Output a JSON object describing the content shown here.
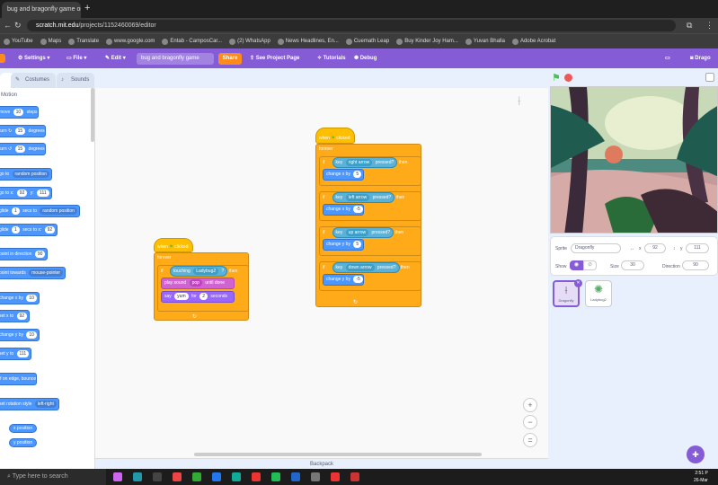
{
  "browser": {
    "tab_title": "bug and bragonfly game on Sc",
    "new_tab": "+",
    "url_host": "scratch.mit.edu",
    "url_path": "/projects/1152460069/editor",
    "bookmarks": [
      "YouTube",
      "Maps",
      "Translate",
      "www.google.com",
      "Entab - CamposCar...",
      "(2) WhatsApp",
      "News Headlines, En...",
      "Cuemath Leap",
      "Buy Kinder Joy Ham...",
      "Yuvan Bhalla",
      "Adobe Acrobat"
    ]
  },
  "menu": {
    "settings": "Settings",
    "file": "File",
    "edit": "Edit",
    "project_title": "bug and bragonfly game",
    "share": "Share",
    "see_project": "See Project Page",
    "tutorials": "Tutorials",
    "debug": "Debug",
    "username": "Drago"
  },
  "editor_tabs": {
    "code": "",
    "costumes": "Costumes",
    "sounds": "Sounds"
  },
  "palette": {
    "category": "Motion",
    "blocks": [
      {
        "text": "move",
        "v1": "10",
        "t2": "steps"
      },
      {
        "text": "turn ↻",
        "v1": "15",
        "t2": "degrees"
      },
      {
        "text": "turn ↺",
        "v1": "15",
        "t2": "degrees"
      },
      {
        "text": "go to",
        "dd": "random position"
      },
      {
        "text": "go to x:",
        "v1": "92",
        "t2": "y:",
        "v2": "111"
      },
      {
        "text": "glide",
        "v1": "1",
        "t2": "secs to",
        "dd": "random position"
      },
      {
        "text": "glide",
        "v1": "1",
        "t2": "secs to x:",
        "v2": "92"
      },
      {
        "text": "point in direction",
        "v1": "90"
      },
      {
        "text": "point towards",
        "dd": "mouse-pointer"
      },
      {
        "text": "change x by",
        "v1": "10"
      },
      {
        "text": "set x to",
        "v1": "92"
      },
      {
        "text": "change y by",
        "v1": "10"
      },
      {
        "text": "set y to",
        "v1": "111"
      },
      {
        "text": "if on edge, bounce"
      },
      {
        "text": "set rotation style",
        "dd": "left-right"
      }
    ],
    "reporters": [
      "x position",
      "y position"
    ]
  },
  "script1": {
    "hat": "when",
    "hat_tail": "clicked",
    "forever": "forever",
    "if": "if",
    "touching": "touching",
    "touching_target": "Ladybug2",
    "touching_q": "?",
    "then": "then",
    "play_sound": "play sound",
    "sound": "pop",
    "until_done": "until done",
    "say": "say",
    "say_text": "yum",
    "for": "for",
    "say_secs": "2",
    "seconds": "seconds"
  },
  "script2": {
    "hat": "when",
    "hat_tail": "clicked",
    "forever": "forever",
    "conditions": [
      {
        "key": "right arrow",
        "action": "change x by",
        "value": "5"
      },
      {
        "key": "left arrow",
        "action": "change x by",
        "value": "-5"
      },
      {
        "key": "up arrow",
        "action": "change y by",
        "value": "5"
      },
      {
        "key": "down arrow",
        "action": "change y by",
        "value": "-5"
      }
    ],
    "key_label": "key",
    "pressed": "pressed?",
    "then": "then",
    "if": "if"
  },
  "backpack": "Backpack",
  "sprite_info": {
    "sprite_label": "Sprite",
    "sprite_name": "Dragonfly",
    "x_label": "x",
    "x": "92",
    "y_label": "y",
    "y": "111",
    "show_label": "Show",
    "size_label": "Size",
    "size": "30",
    "direction_label": "Direction",
    "direction": "90"
  },
  "sprites": [
    {
      "name": "Dragonfly",
      "selected": true
    },
    {
      "name": "Ladybug2",
      "selected": false
    }
  ],
  "taskbar": {
    "search": "Type here to search",
    "time": "2:51 P",
    "date": "26-Mar"
  },
  "colors": {
    "menu": "#855cd6",
    "motion": "#4c97ff",
    "control": "#ffab19",
    "events": "#ffbf00",
    "sensing": "#5cb1d6",
    "sound": "#cf63cf",
    "looks": "#9966ff"
  }
}
